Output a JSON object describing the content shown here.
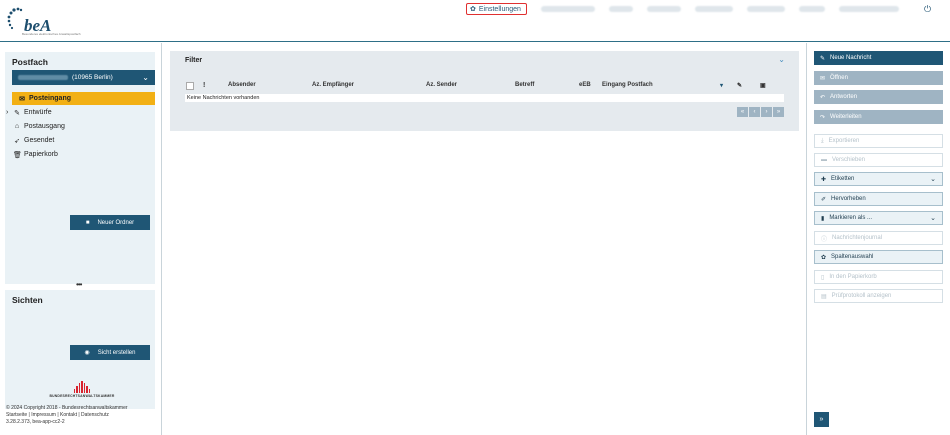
{
  "app": {
    "logo_text": "beA",
    "logo_sub": "Besonderes elektronisches Anwaltspostfach"
  },
  "topnav": {
    "settings_label": "Einstellungen"
  },
  "colors": {
    "primary": "#1f5675",
    "accent": "#f2b015",
    "highlight_border": "#e03030"
  },
  "sidebar": {
    "postfach_title": "Postfach",
    "postfach_selected": "(10965 Berlin)",
    "folders": [
      {
        "label": "Posteingang",
        "icon": "inbox-icon",
        "active": true
      },
      {
        "label": "Entwürfe",
        "icon": "draft-icon",
        "active": false
      },
      {
        "label": "Postausgang",
        "icon": "outbox-icon",
        "active": false
      },
      {
        "label": "Gesendet",
        "icon": "sent-icon",
        "active": false
      },
      {
        "label": "Papierkorb",
        "icon": "trash-icon",
        "active": false
      }
    ],
    "new_folder_label": "Neuer Ordner",
    "views_title": "Sichten",
    "create_view_label": "Sicht erstellen",
    "brak_text": "BUNDESRECHTSANWALTSKAMMER",
    "footer_lines": [
      "© 2024 Copyright 2018 - Bundesrechtsanwaltskammer",
      "Startseite | Impressum | Kontakt | Datenschutz",
      "3.28.2.373, bea-app-cc2-2"
    ]
  },
  "main": {
    "filter_title": "Filter",
    "columns": [
      "!",
      "Absender",
      "Az. Empfänger",
      "Az. Sender",
      "Betreff",
      "eEB",
      "Eingang Postfach"
    ],
    "empty_message": "Keine Nachrichten vorhanden",
    "pager": [
      "«",
      "‹",
      "›",
      "»"
    ]
  },
  "actions": [
    {
      "label": "Neue Nachricht",
      "icon": "pencil-icon",
      "style": "primary"
    },
    {
      "label": "Öffnen",
      "icon": "envelope-icon",
      "style": "disabled-dark"
    },
    {
      "label": "Antworten",
      "icon": "reply-icon",
      "style": "disabled-dark"
    },
    {
      "label": "Weiterleiten",
      "icon": "forward-icon",
      "style": "disabled-dark"
    },
    {
      "label": "Exportieren",
      "icon": "export-icon",
      "style": "outline-dis"
    },
    {
      "label": "Verschieben",
      "icon": "folder-icon",
      "style": "outline-dis"
    },
    {
      "label": "Etiketten",
      "icon": "tag-icon",
      "style": "outline",
      "dropdown": true
    },
    {
      "label": "Hervorheben",
      "icon": "highlight-icon",
      "style": "outline"
    },
    {
      "label": "Markieren als ...",
      "icon": "bookmark-icon",
      "style": "outline",
      "dropdown": true
    },
    {
      "label": "Nachrichtenjournal",
      "icon": "info-icon",
      "style": "outline-dis"
    },
    {
      "label": "Spaltenauswahl",
      "icon": "gear-icon",
      "style": "outline"
    },
    {
      "label": "In den Papierkorb",
      "icon": "trash-icon",
      "style": "outline-dis"
    },
    {
      "label": "Prüfprotokoll anzeigen",
      "icon": "document-icon",
      "style": "outline-dis"
    }
  ],
  "expand_label": "»"
}
